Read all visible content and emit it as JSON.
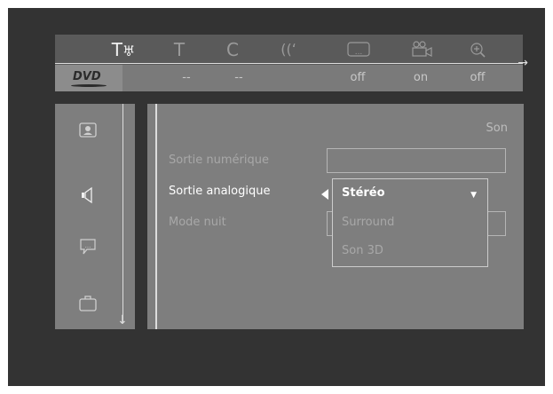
{
  "top_menu": [
    {
      "icon": "tools-icon",
      "glyph": "T♅",
      "active": true
    },
    {
      "icon": "title-icon",
      "glyph": "T",
      "active": false
    },
    {
      "icon": "chapter-icon",
      "glyph": "C",
      "active": false
    },
    {
      "icon": "audio-icon",
      "glyph": "((‘",
      "active": false
    },
    {
      "icon": "subtitle-icon",
      "glyph": "…",
      "active": false
    },
    {
      "icon": "angle-icon",
      "glyph": "⎉",
      "active": false
    },
    {
      "icon": "zoom-icon",
      "glyph": "⊕",
      "active": false
    }
  ],
  "status": {
    "brand": "DVD",
    "values": [
      "--",
      "--",
      "off",
      "on",
      "off"
    ]
  },
  "sidebar": {
    "items": [
      {
        "icon": "picture-icon",
        "glyph": "▣"
      },
      {
        "icon": "speaker-icon",
        "glyph": "◁"
      },
      {
        "icon": "speech-bubble-icon",
        "glyph": "✉"
      },
      {
        "icon": "briefcase-icon",
        "glyph": "▢"
      }
    ]
  },
  "panel": {
    "title": "Son",
    "rows": [
      {
        "label": "Sortie numérique"
      },
      {
        "label": "Sortie analogique"
      },
      {
        "label": "Mode nuit"
      }
    ],
    "dropdown": {
      "options": [
        "Stéréo",
        "Surround",
        "Son 3D"
      ],
      "selected": "Stéréo"
    }
  }
}
